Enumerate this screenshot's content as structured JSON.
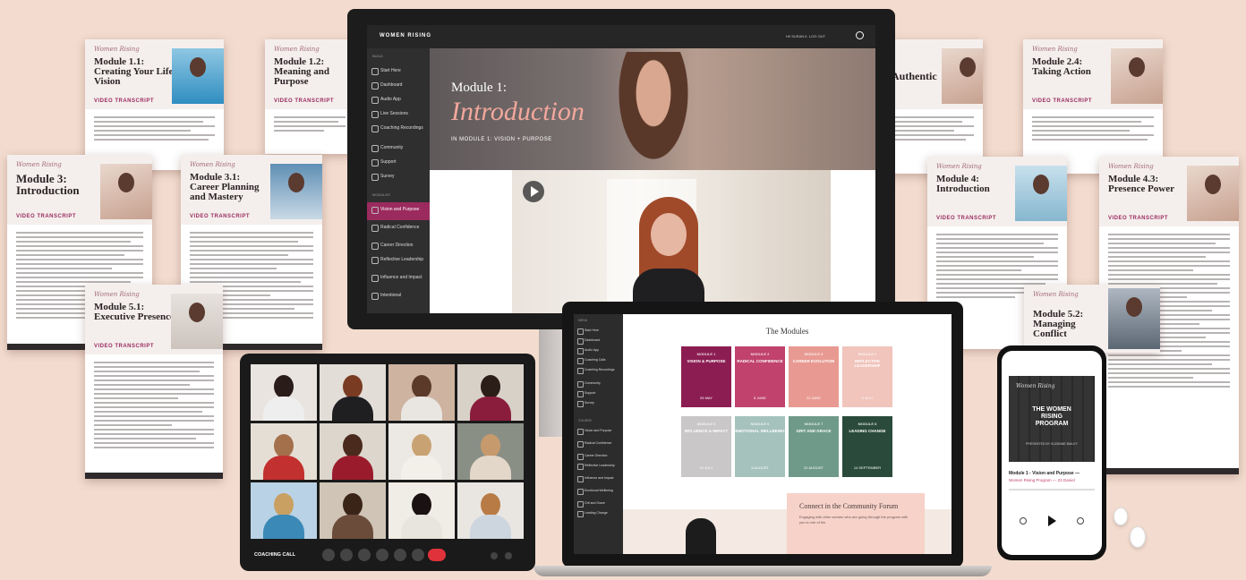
{
  "brand_script": "Women Rising",
  "transcript_label": "VIDEO TRANSCRIPT",
  "documents": [
    {
      "title": "Module 1.1: Creating Your Life Vision"
    },
    {
      "title": "Module 1.2: Meaning and Purpose"
    },
    {
      "title": "Module 3: Introduction"
    },
    {
      "title": "Module 3.1: Career Planning and Mastery"
    },
    {
      "title": "Module 5.1: Executive Presence"
    },
    {
      "title": "Authentic"
    },
    {
      "title": "Module 2.4: Taking Action"
    },
    {
      "title": "Module 4: Introduction"
    },
    {
      "title": "Module 4.3: Presence Power"
    },
    {
      "title": "Module 5.2: Managing Conflict"
    }
  ],
  "monitor": {
    "logo": "WOMEN RISING",
    "user": "HI! SUSAN K. LOG OUT",
    "nav_heading": "BUILD",
    "nav": [
      "Start Here",
      "Dashboard",
      "Audio App",
      "Live Sessions",
      "Coaching Recordings",
      "Community",
      "Support",
      "Survey"
    ],
    "modules_heading": "MODULES",
    "modules": [
      "Vision and Purpose",
      "Radical Confidence",
      "Career Direction",
      "Reflective Leadership",
      "Influence and Impact",
      "Intentional"
    ],
    "hero_kicker": "Module 1:",
    "hero_title": "Introduction",
    "hero_sub": "IN MODULE 1: VISION + PURPOSE"
  },
  "laptop": {
    "nav_heading": "MENU",
    "nav": [
      "Start Here",
      "Dashboard",
      "Audio App",
      "Coaching Calls",
      "Coaching Recordings",
      "Community",
      "Support",
      "Survey"
    ],
    "modules_heading": "COURSE",
    "modules": [
      "Vision and Purpose",
      "Radical Confidence",
      "Career Direction",
      "Reflective Leadership",
      "Influence and Impact",
      "Emotional Wellbeing",
      "Grit and Grace",
      "Leading Change"
    ],
    "heading": "The Modules",
    "tiles": [
      {
        "num": "MODULE 1",
        "name": "VISION & PURPOSE",
        "date": "25 MAY",
        "color": "#8c1d52"
      },
      {
        "num": "MODULE 2",
        "name": "RADICAL CONFIDENCE",
        "date": "8 JUNE",
        "color": "#c0426d"
      },
      {
        "num": "MODULE 3",
        "name": "CAREER EVOLUTION",
        "date": "22 JUNE",
        "color": "#e89a92"
      },
      {
        "num": "MODULE 4",
        "name": "REFLECTIVE LEADERSHIP",
        "date": "6 JULY",
        "color": "#f1c4bc"
      },
      {
        "num": "MODULE 5",
        "name": "INFLUENCE & IMPACT",
        "date": "20 JULY",
        "color": "#c9c7c7"
      },
      {
        "num": "MODULE 6",
        "name": "EMOTIONAL WELLBEING",
        "date": "3 AUGUST",
        "color": "#a6c2bd"
      },
      {
        "num": "MODULE 7",
        "name": "GRIT AND GRACE",
        "date": "31 AUGUST",
        "color": "#6f9a8a"
      },
      {
        "num": "MODULE 8",
        "name": "LEADING CHANGE",
        "date": "14 SEPTEMBER",
        "color": "#2a4b3b"
      }
    ],
    "forum_title": "Connect in the Community Forum",
    "forum_text": "Engaging with other women who are going through the program with you is one of the"
  },
  "tablet": {
    "label": "COACHING CALL"
  },
  "phone": {
    "art_brand": "Women Rising",
    "art_title": "THE WOMEN RISING PROGRAM",
    "art_sub": "PRESENTED BY SUZANNE BAILEY",
    "track": "Module 1 - Vision and Purpose —",
    "artist": "Women Rising Program — 23 Daniel"
  },
  "colors": {
    "accent": "#9b2a5e",
    "background": "#f3dccf",
    "dark": "#1c1c1c"
  },
  "icons": [
    "play-icon",
    "search-icon",
    "mic-icon",
    "camera-icon",
    "share-icon",
    "end-call-icon",
    "rewind-icon",
    "forward-icon"
  ]
}
